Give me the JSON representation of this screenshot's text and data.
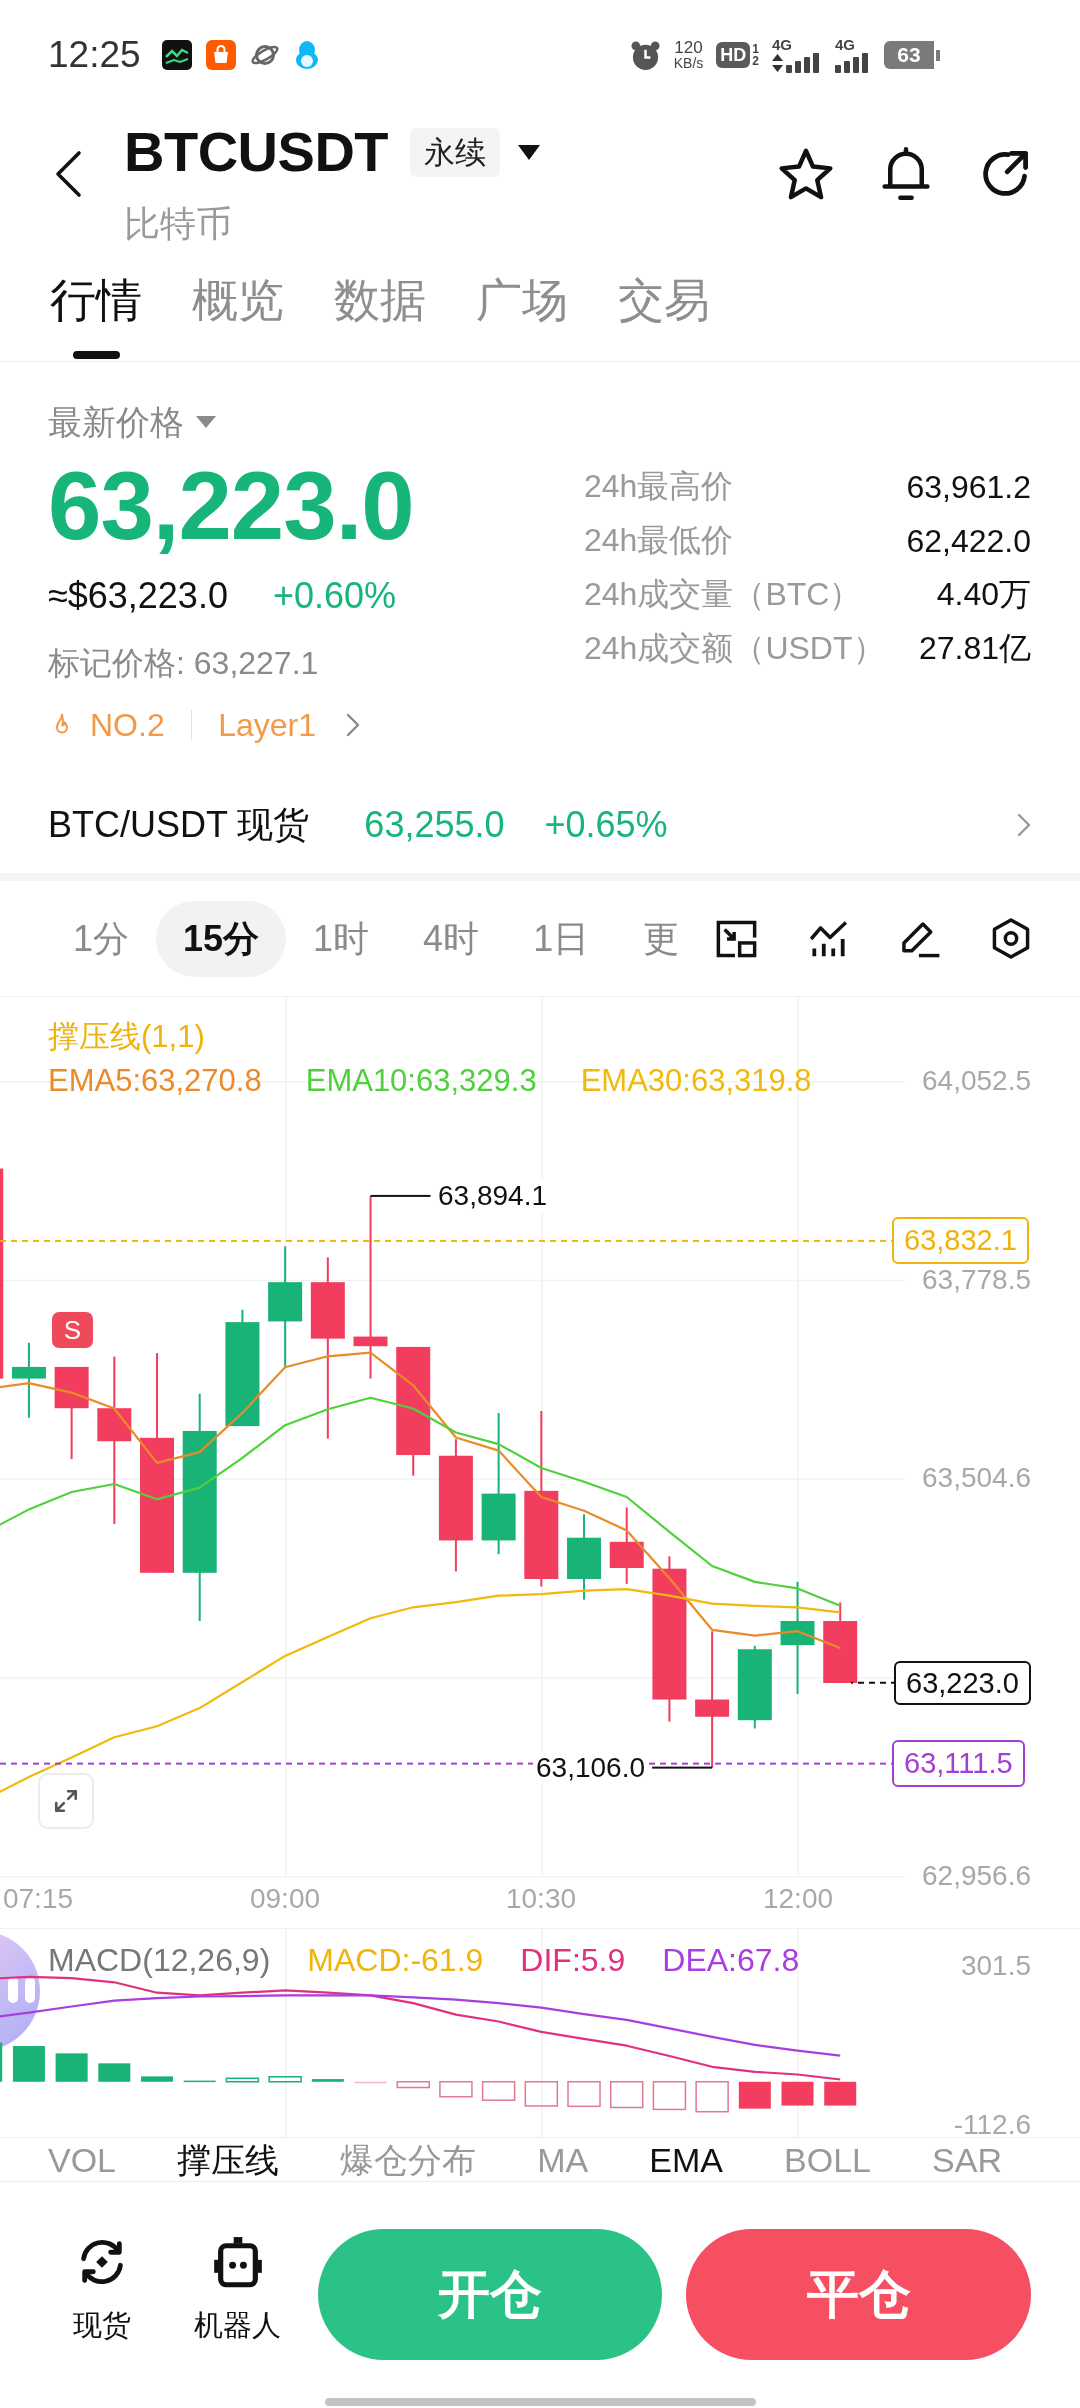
{
  "status_bar": {
    "time": "12:25",
    "speed": "120",
    "speed_unit": "KB/s",
    "hd": {
      "label": "HD",
      "sup": "1",
      "sub": "2"
    },
    "networks": [
      {
        "label": "4G",
        "data_active": true
      },
      {
        "label": "4G",
        "data_active": false
      }
    ],
    "battery": "63"
  },
  "header": {
    "title": "BTCUSDT",
    "contract": "永续",
    "subtitle": "比特币"
  },
  "tabs": [
    {
      "label": "行情",
      "selected": true
    },
    {
      "label": "概览",
      "selected": false
    },
    {
      "label": "数据",
      "selected": false
    },
    {
      "label": "广场",
      "selected": false
    },
    {
      "label": "交易",
      "selected": false
    }
  ],
  "ticker": {
    "price_label": "最新价格",
    "last_price": "63,223.0",
    "usd_price": "≈$63,223.0",
    "change": "+0.60%",
    "mark_price": "标记价格: 63,227.1",
    "rank": "NO.2",
    "sector": "Layer1",
    "stats": [
      {
        "label": "24h最高价",
        "value": "63,961.2"
      },
      {
        "label": "24h最低价",
        "value": "62,422.0"
      },
      {
        "label": "24h成交量（BTC）",
        "value": "4.40万"
      },
      {
        "label": "24h成交额（USDT）",
        "value": "27.81亿"
      }
    ]
  },
  "spot": {
    "pair": "BTC/USDT 现货",
    "price": "63,255.0",
    "change": "+0.65%"
  },
  "intervals": [
    {
      "label": "1分",
      "selected": false
    },
    {
      "label": "15分",
      "selected": true
    },
    {
      "label": "1时",
      "selected": false
    },
    {
      "label": "4时",
      "selected": false
    },
    {
      "label": "1日",
      "selected": false
    },
    {
      "label": "更",
      "selected": false
    }
  ],
  "chart": {
    "legend_title": "撑压线(1,1)",
    "ema": [
      {
        "label": "EMA5:63,270.8",
        "color": "#e98b2a"
      },
      {
        "label": "EMA10:63,329.3",
        "color": "#4fd13c"
      },
      {
        "label": "EMA30:63,319.8",
        "color": "#f0b90b"
      }
    ],
    "signal_marker": "S",
    "chart_data": {
      "type": "line",
      "categories": [
        null,
        "07:15",
        null,
        null,
        null,
        null,
        null,
        "09:00",
        null,
        null,
        null,
        null,
        null,
        "10:30",
        null,
        null,
        null,
        null,
        null,
        "12:00",
        null
      ],
      "series": [
        {
          "color": "#e98b2a",
          "values": [
            63628,
            63636,
            63623,
            63601,
            63526,
            63541,
            63595,
            63658,
            63673,
            63678,
            63633,
            63561,
            63543,
            63479,
            63460,
            63433,
            63367,
            63296,
            63288,
            63294,
            63271
          ]
        },
        {
          "color": "#4fd13c",
          "values": [
            63431,
            63462,
            63486,
            63497,
            63476,
            63492,
            63533,
            63578,
            63600,
            63616,
            63601,
            63568,
            63552,
            63519,
            63500,
            63479,
            63431,
            63384,
            63362,
            63353,
            63329
          ]
        },
        {
          "color": "#f0b90b",
          "values": [
            63063,
            63093,
            63120,
            63148,
            63163,
            63188,
            63224,
            63260,
            63286,
            63312,
            63327,
            63334,
            63343,
            63345,
            63350,
            63352,
            63343,
            63332,
            63329,
            63327,
            63320
          ]
        }
      ],
      "ylim": [
        62956.6,
        64052.5
      ],
      "yticks": [
        {
          "value": 64052.5,
          "label": "64,052.5"
        },
        {
          "value": 63778.5,
          "label": "63,778.5"
        },
        {
          "value": 63504.6,
          "label": "63,504.6"
        },
        {
          "value": 62956.6,
          "label": "62,956.6"
        }
      ],
      "ref_lines": [
        {
          "axis": "y",
          "value": 63832.1,
          "label": "63,832.1",
          "color": "#eeb30e"
        },
        {
          "axis": "y",
          "value": 63223.0,
          "label": "63,223.0",
          "color": "#111111"
        },
        {
          "axis": "y",
          "value": 63111.5,
          "label": "63,111.5",
          "color": "#a33ed6"
        },
        {
          "axis": "y",
          "value": 63894.1,
          "label": "63,894.1",
          "color": "#111111"
        },
        {
          "axis": "y",
          "value": 63106.0,
          "label": "63,106.0",
          "color": "#111111"
        }
      ]
    }
  },
  "macd": {
    "title": "MACD(12,26,9)",
    "values": [
      {
        "label": "MACD:-61.9",
        "color": "#efb50d"
      },
      {
        "label": "DIF:5.9",
        "color": "#e0307f"
      },
      {
        "label": "DEA:67.8",
        "color": "#a83de0"
      }
    ],
    "chart_data": {
      "type": "line",
      "series": [
        {
          "color": "#e0307f",
          "values": [
            268,
            273,
            270,
            259,
            232,
            225,
            232,
            238,
            232,
            225,
            205,
            175,
            157,
            130,
            112,
            94,
            67,
            39,
            26,
            19,
            6
          ]
        },
        {
          "color": "#a83de0",
          "values": [
            166,
            180,
            196,
            211,
            218,
            222,
            223,
            225,
            225,
            225,
            220,
            214,
            205,
            193,
            176,
            161,
            139,
            117,
            96,
            81,
            68
          ]
        }
      ],
      "ylim": [
        -112.6,
        301.5
      ],
      "yticks": [
        {
          "value": 301.5,
          "label": "301.5"
        },
        {
          "value": -112.6,
          "label": "-112.6"
        }
      ]
    }
  },
  "indicators": [
    {
      "label": "VOL",
      "selected": false
    },
    {
      "label": "撑压线",
      "selected": true
    },
    {
      "label": "爆仓分布",
      "selected": false
    },
    {
      "label": "MA",
      "selected": false
    },
    {
      "label": "EMA",
      "selected": true
    },
    {
      "label": "BOLL",
      "selected": false
    },
    {
      "label": "SAR",
      "selected": false
    }
  ],
  "bottom_bar": {
    "shortcuts": [
      {
        "kind": "spot",
        "label": "现货"
      },
      {
        "kind": "robot",
        "label": "机器人"
      }
    ],
    "actions": [
      {
        "kind": "open",
        "label": "开仓"
      },
      {
        "kind": "close",
        "label": "平仓"
      }
    ]
  }
}
